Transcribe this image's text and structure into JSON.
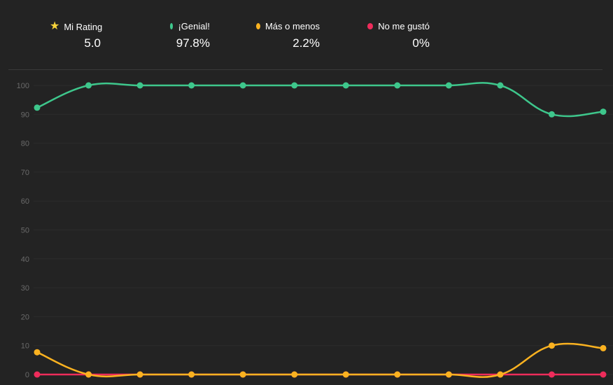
{
  "legend": [
    {
      "id": "rating",
      "label": "Mi Rating",
      "value": "5.0",
      "icon": "star-icon",
      "color": "#f7d33a"
    },
    {
      "id": "genial",
      "label": "¡Genial!",
      "value": "97.8%",
      "icon": "dot",
      "color": "#3ec78c"
    },
    {
      "id": "mas",
      "label": "Más o menos",
      "value": "2.2%",
      "icon": "dot",
      "color": "#fbb220"
    },
    {
      "id": "no",
      "label": "No me gustó",
      "value": "0%",
      "icon": "dot",
      "color": "#ee2c5b"
    }
  ],
  "chart_data": {
    "type": "line",
    "title": "",
    "xlabel": "",
    "ylabel": "",
    "ylim": [
      0,
      100
    ],
    "yticks": [
      "0",
      "10",
      "20",
      "30",
      "40",
      "50",
      "60",
      "70",
      "80",
      "90",
      "100"
    ],
    "grid": true,
    "x": [
      1,
      2,
      3,
      4,
      5,
      6,
      7,
      8,
      9,
      10,
      11,
      12
    ],
    "series": [
      {
        "name": "¡Genial!",
        "color": "#3ec78c",
        "values": [
          92.3,
          100,
          100,
          100,
          100,
          100,
          100,
          100,
          100,
          100,
          90,
          90.9
        ]
      },
      {
        "name": "Más o menos",
        "color": "#fbb220",
        "values": [
          7.7,
          0,
          0,
          0,
          0,
          0,
          0,
          0,
          0,
          0,
          10,
          9.1
        ]
      },
      {
        "name": "No me gustó",
        "color": "#ee2c5b",
        "values": [
          0,
          0,
          0,
          0,
          0,
          0,
          0,
          0,
          0,
          0,
          0,
          0
        ]
      }
    ]
  }
}
